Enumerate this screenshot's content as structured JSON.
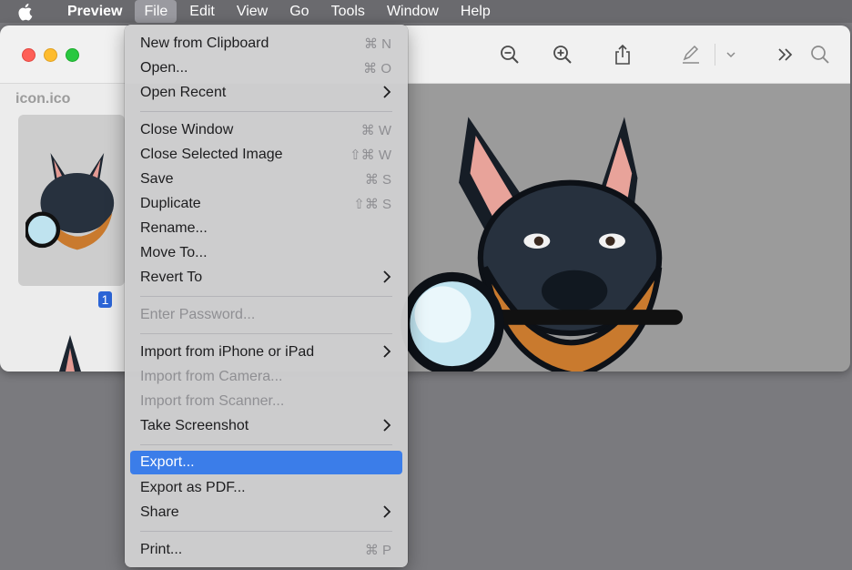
{
  "menubar": {
    "app": "Preview",
    "items": [
      "File",
      "Edit",
      "View",
      "Go",
      "Tools",
      "Window",
      "Help"
    ]
  },
  "window": {
    "sidebar": {
      "title": "icon.ico",
      "page_badge": "1"
    }
  },
  "file_menu": {
    "items": [
      {
        "label": "New from Clipboard",
        "shortcut": "⌘ N"
      },
      {
        "label": "Open...",
        "shortcut": "⌘ O"
      },
      {
        "label": "Open Recent",
        "shortcut": ""
      },
      {
        "label": "Close Window",
        "shortcut": "⌘ W"
      },
      {
        "label": "Close Selected Image",
        "shortcut": "⇧⌘ W"
      },
      {
        "label": "Save",
        "shortcut": "⌘ S"
      },
      {
        "label": "Duplicate",
        "shortcut": "⇧⌘ S"
      },
      {
        "label": "Rename...",
        "shortcut": ""
      },
      {
        "label": "Move To...",
        "shortcut": ""
      },
      {
        "label": "Revert To",
        "shortcut": ""
      },
      {
        "label": "Enter Password...",
        "shortcut": ""
      },
      {
        "label": "Import from iPhone or iPad",
        "shortcut": ""
      },
      {
        "label": "Import from Camera...",
        "shortcut": ""
      },
      {
        "label": "Import from Scanner...",
        "shortcut": ""
      },
      {
        "label": "Take Screenshot",
        "shortcut": ""
      },
      {
        "label": "Export...",
        "shortcut": ""
      },
      {
        "label": "Export as PDF...",
        "shortcut": ""
      },
      {
        "label": "Share",
        "shortcut": ""
      },
      {
        "label": "Print...",
        "shortcut": "⌘ P"
      }
    ]
  },
  "colors": {
    "highlight": "#3b7de9",
    "menubar": "#6a6a6e",
    "desktop": "#7a7a7e"
  },
  "icons": {
    "toolbar": [
      "zoom-out-icon",
      "zoom-in-icon",
      "share-icon",
      "markup-pen-icon",
      "chevron-down-icon",
      "more-icon",
      "search-icon"
    ],
    "submenu": "chevron-right-icon"
  }
}
